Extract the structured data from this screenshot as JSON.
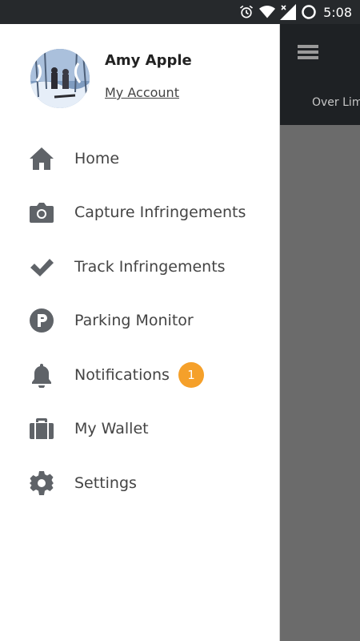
{
  "status_bar": {
    "time": "5:08",
    "icons": [
      "alarm-icon",
      "wifi-icon",
      "no-signal-icon",
      "data-saver-icon"
    ]
  },
  "background_app": {
    "tab_partial": "Over Lim"
  },
  "drawer": {
    "user": {
      "name": "Amy Apple",
      "account_link": "My Account"
    },
    "items": [
      {
        "label": "Home",
        "icon": "home-icon"
      },
      {
        "label": "Capture Infringements",
        "icon": "camera-icon"
      },
      {
        "label": "Track Infringements",
        "icon": "checkmark-icon"
      },
      {
        "label": "Parking Monitor",
        "icon": "parking-icon"
      },
      {
        "label": "Notifications",
        "icon": "bell-icon",
        "badge": "1"
      },
      {
        "label": "My Wallet",
        "icon": "wallet-icon"
      },
      {
        "label": "Settings",
        "icon": "gear-icon"
      }
    ]
  },
  "colors": {
    "icon": "#5f6368",
    "badge": "#f5a02a",
    "overlay": "#6b6b6b",
    "header": "#1e2124"
  }
}
